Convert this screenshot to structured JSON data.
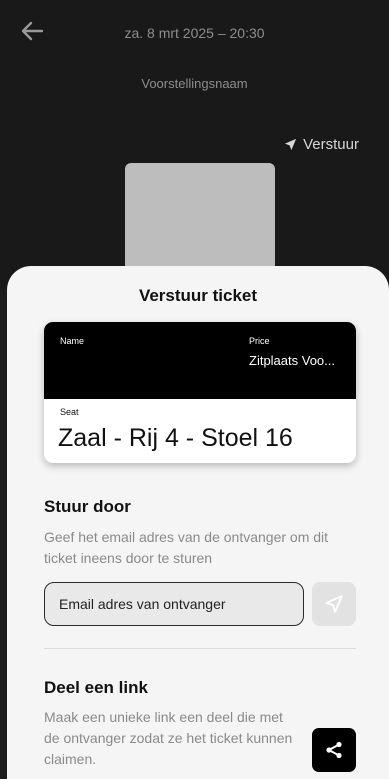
{
  "header": {
    "datetime": "za. 8 mrt 2025 – 20:30",
    "show_name": "Voorstellingsnaam",
    "send_label": "Verstuur",
    "back_icon": "arrow-left-icon",
    "send_icon": "paper-plane-icon"
  },
  "sheet": {
    "title": "Verstuur ticket"
  },
  "ticket": {
    "name_label": "Name",
    "price_label": "Price",
    "price_value": "Zitplaats Voo...",
    "seat_label": "Seat",
    "seat_value": "Zaal - Rij 4 - Stoel 16"
  },
  "forward": {
    "title": "Stuur door",
    "description": "Geef het email adres van de ontvanger om dit ticket ineens door te sturen",
    "email_placeholder": "Email adres van ontvanger",
    "email_value": "",
    "send_icon": "paper-plane-outline-icon"
  },
  "share": {
    "title": "Deel een link",
    "description": "Maak een unieke link een deel die met de ontvanger zodat ze het ticket kunnen claimen.",
    "share_icon": "share-icon"
  },
  "colors": {
    "background": "#191919",
    "sheet": "#f5f5f5",
    "ticket_header": "#000000",
    "muted_text": "#8a8a8a",
    "send_button": "#e2e2e2",
    "share_button": "#000000"
  }
}
